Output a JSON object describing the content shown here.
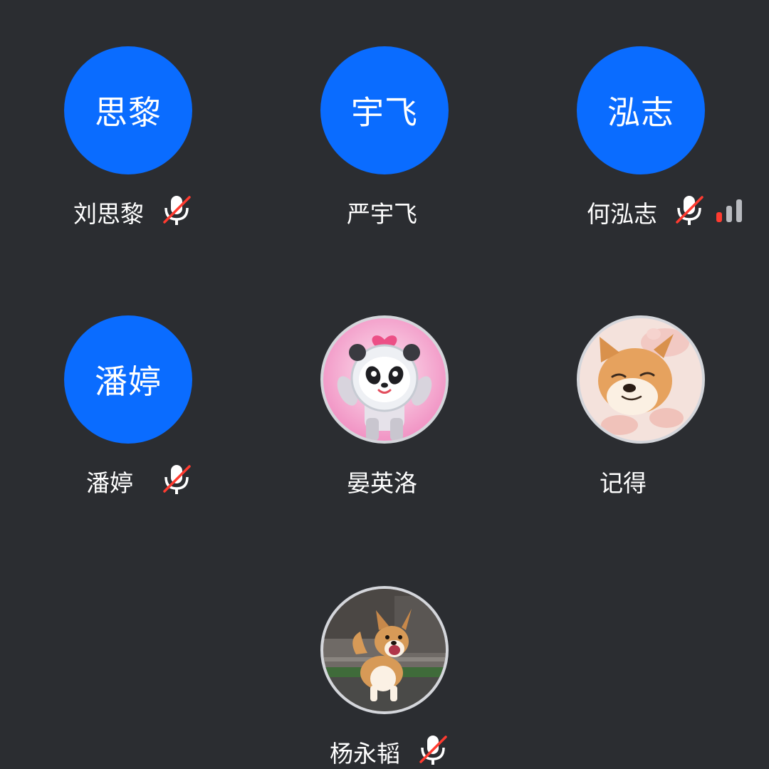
{
  "colors": {
    "background": "#2b2d31",
    "avatar_blue": "#0a6cff",
    "mute_slash": "#ff3b30",
    "signal_weak": "#ff3b30",
    "signal_idle": "#b8babf"
  },
  "participants": [
    {
      "avatar_text": "思黎",
      "name": "刘思黎",
      "muted": true
    },
    {
      "avatar_text": "宇飞",
      "name": "严宇飞",
      "muted": false
    },
    {
      "avatar_text": "泓志",
      "name": "何泓志",
      "muted": true,
      "signal_bars_active": 1,
      "signal_bars_total": 3
    },
    {
      "avatar_text": "潘婷",
      "name": "潘婷",
      "muted": true
    },
    {
      "avatar_icon": "panda-mascot-avatar",
      "name": "晏英洛",
      "muted": false
    },
    {
      "avatar_icon": "shiba-dog-avatar",
      "name": "记得",
      "muted": false
    },
    {
      "avatar_icon": "corgi-dog-avatar",
      "name": "杨永韬",
      "muted": true
    }
  ]
}
